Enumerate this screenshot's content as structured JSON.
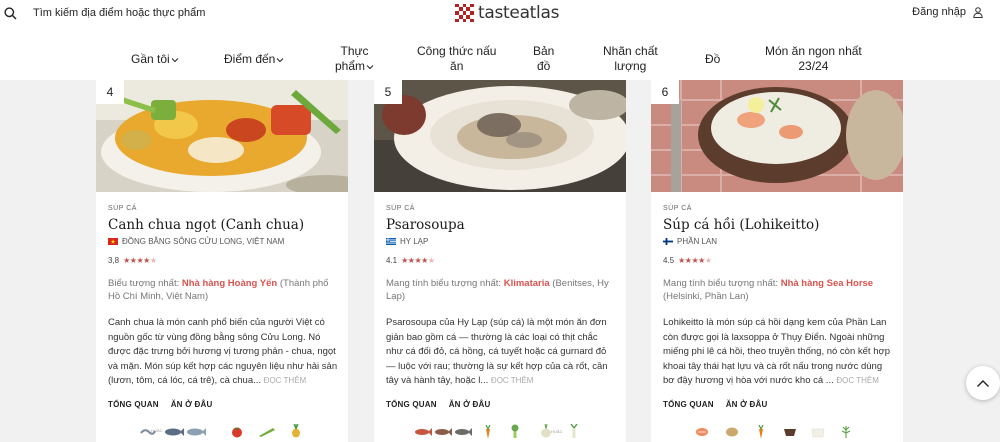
{
  "header": {
    "search_placeholder": "Tìm kiếm địa điểm hoặc thực phẩm",
    "logo_text": "tasteatlas",
    "login_label": "Đăng nhập",
    "accent": "#c0392b"
  },
  "nav": {
    "near_me": "Gần tôi",
    "destinations": "Điểm đến",
    "food_line1": "Thực",
    "food_line2": "phẩm",
    "recipes_line1": "Công thức nấu",
    "recipes_line2": "ăn",
    "map_line1": "Bản",
    "map_line2": "đồ",
    "quality_line1": "Nhãn chất",
    "quality_line2": "lượng",
    "drinks": "Đồ",
    "best_line1": "Món ăn ngon nhất",
    "best_line2": "23/24"
  },
  "cards": [
    {
      "rank": "4",
      "category": "Súp cá",
      "title": "Canh chua ngọt (Canh chua)",
      "origin": "Đồng bằng sông Cửu Long, Việt Nam",
      "flag": "vietnam-flag",
      "rating": "3,8",
      "stars": 3.8,
      "iconic_label": "Biểu tượng nhất:",
      "iconic_place": "Nhà hàng Hoàng Yến",
      "iconic_location": "(Thành phố Hồ Chí Minh, Việt Nam)",
      "description": "Canh chua là món canh phổ biến của người Việt có nguồn gốc từ vùng đồng bằng sông Cửu Long. Nó được đặc trưng bởi hương vị tương phản - chua, ngọt và mặn. Món súp kết hợp các nguyên liệu như hải sản (lươn, tôm, cá lóc, cá trê), cà chua...",
      "read_more": "ĐỌC THÊM",
      "tab_overview": "TỔNG QUAN",
      "tab_where": "ĂN Ở ĐÂU",
      "ingredient_or": "HOẶC"
    },
    {
      "rank": "5",
      "category": "Súp cá",
      "title": "Psarosoupa",
      "origin": "Hy Lạp",
      "flag": "greece-flag",
      "rating": "4.1",
      "stars": 4.1,
      "iconic_label": "Mang tính biểu tượng nhất:",
      "iconic_place": "Klimataria",
      "iconic_location": "(Benitses, Hy Lạp)",
      "description": "Psarosoupa của Hy Lạp (súp cá) là một món ăn đơn giản bao gồm cá — thường là các loại có thịt chắc như cá đối đỏ, cá hồng, cá tuyết hoặc cá gurnard đỏ — luộc với rau; thường là sự kết hợp của cà rốt, cần tây và hành tây, hoặc l...",
      "read_more": "ĐỌC THÊM",
      "tab_overview": "TỔNG QUAN",
      "tab_where": "ĂN Ở ĐÂU",
      "ingredient_or": "HOẶC"
    },
    {
      "rank": "6",
      "category": "Súp cá",
      "title": "Súp cá hồi (Lohikeitto)",
      "origin": "Phần Lan",
      "flag": "finland-flag",
      "rating": "4.5",
      "stars": 4.5,
      "iconic_label": "Mang tính biểu tượng nhất:",
      "iconic_place": "Nhà hàng Sea Horse",
      "iconic_location": "(Helsinki, Phần Lan)",
      "description": "Lohikeitto là món súp cá hồi dạng kem của Phần Lan còn được gọi là laxsoppa ở Thụy Điển. Ngoài những miếng phi lê cá hồi, theo truyền thống, nó còn kết hợp khoai tây thái hạt lựu và cà rốt nấu trong nước dùng bơ đậy hương vị hòa với nước kho cá ...",
      "read_more": "ĐỌC THÊM",
      "tab_overview": "TỔNG QUAN",
      "tab_where": "ĂN Ở ĐÂU"
    }
  ]
}
